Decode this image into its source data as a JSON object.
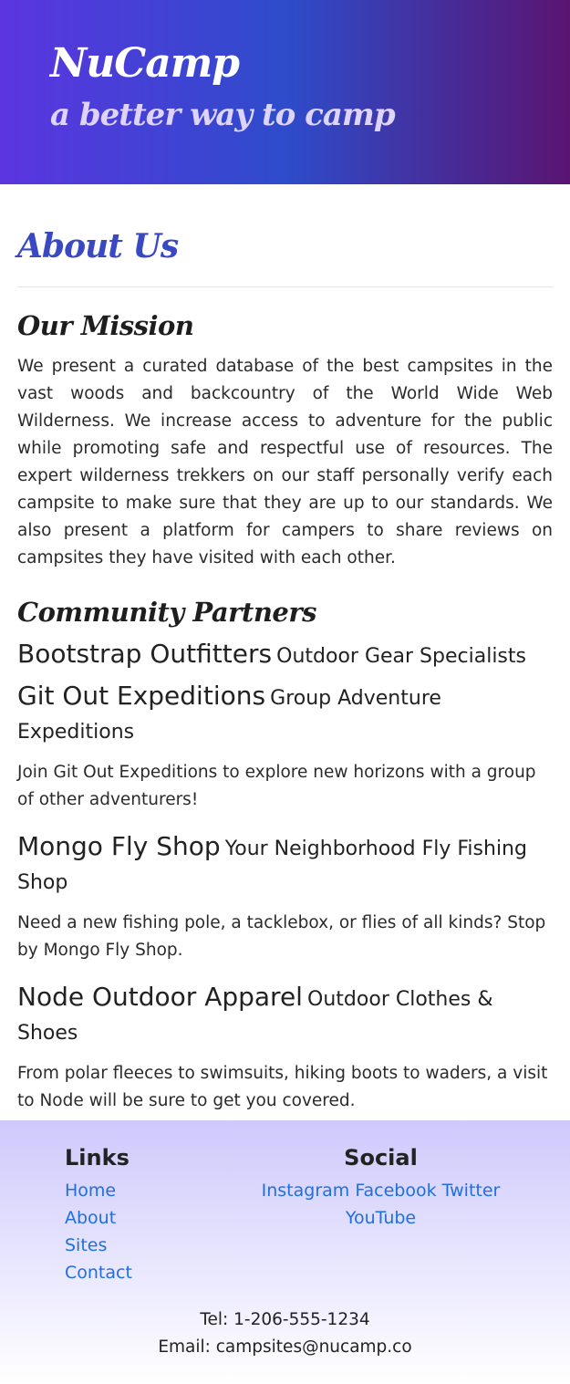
{
  "header": {
    "brand": "NuCamp",
    "tagline": "a better way to camp"
  },
  "page": {
    "title": "About Us"
  },
  "mission": {
    "title": "Our Mission",
    "text": "We present a curated database of the best campsites in the vast woods and backcountry of the World Wide Web Wilderness. We increase access to adventure for the public while promoting safe and respectful use of resources. The expert wilderness trekkers on our staff personally verify each campsite to make sure that they are up to our standards. We also present a platform for campers to share reviews on campsites they have visited with each other."
  },
  "partners": {
    "title": "Community Partners",
    "items": [
      {
        "name": "Bootstrap Outfitters",
        "feature": "Outdoor Gear Specialists",
        "description": ""
      },
      {
        "name": "Git Out Expeditions",
        "feature": "Group Adventure Expeditions",
        "description": "Join Git Out Expeditions to explore new horizons with a group of other adventurers!"
      },
      {
        "name": "Mongo Fly Shop",
        "feature": "Your Neighborhood Fly Fishing Shop",
        "description": "Need a new fishing pole, a tacklebox, or flies of all kinds? Stop by Mongo Fly Shop."
      },
      {
        "name": "Node Outdoor Apparel",
        "feature": "Outdoor Clothes & Shoes",
        "description": "From polar fleeces to swimsuits, hiking boots to waders, a visit to Node will be sure to get you covered."
      }
    ]
  },
  "footer": {
    "links_title": "Links",
    "links": [
      "Home",
      "About",
      "Sites",
      "Contact"
    ],
    "social_title": "Social",
    "social": [
      "Instagram",
      "Facebook",
      "Twitter",
      "YouTube"
    ],
    "tel": "Tel: 1-206-555-1234",
    "email": "Email: campsites@nucamp.co"
  },
  "colors": {
    "link": "#1f6fe0",
    "page_title": "#3a48c2"
  }
}
